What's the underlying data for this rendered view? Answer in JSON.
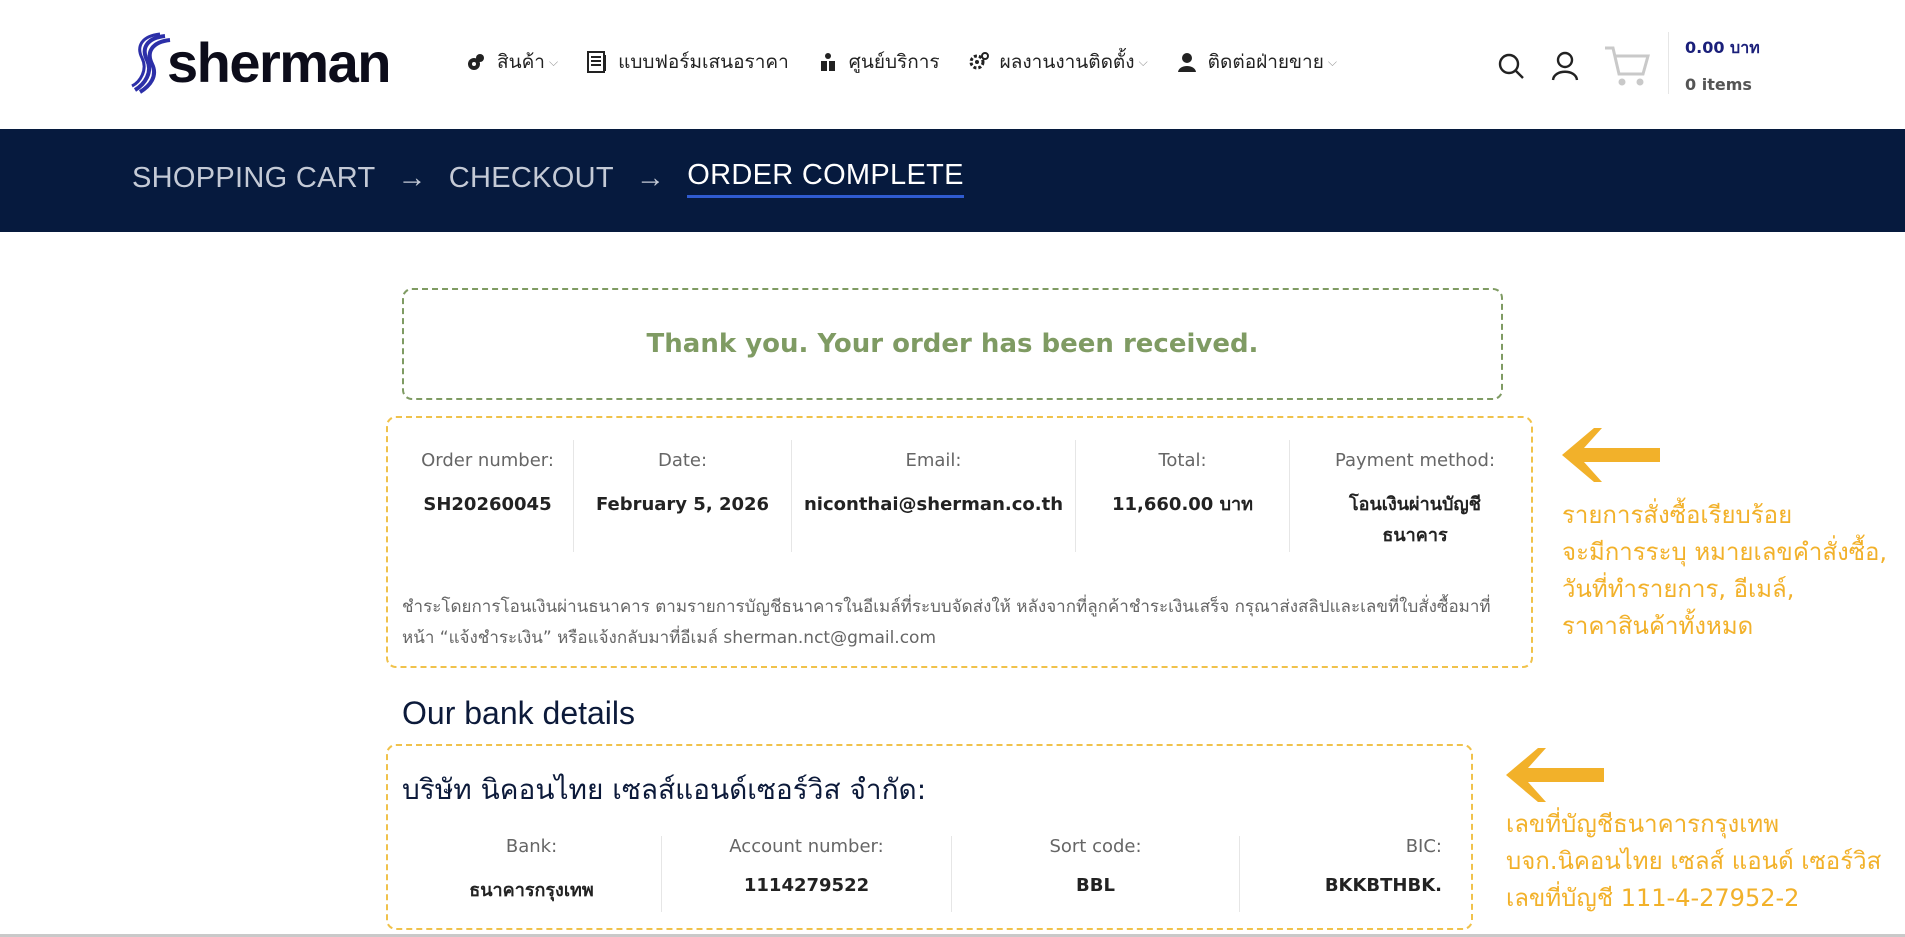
{
  "brand": {
    "name": "sherman"
  },
  "nav": {
    "items": [
      {
        "label": "สินค้า",
        "icon": "tools-icon",
        "has_dropdown": true
      },
      {
        "label": "แบบฟอร์มเสนอราคา",
        "icon": "form-icon",
        "has_dropdown": false
      },
      {
        "label": "ศูนย์บริการ",
        "icon": "service-center-icon",
        "has_dropdown": false
      },
      {
        "label": "ผลงานงานติดตั้ง",
        "icon": "gear-icon",
        "has_dropdown": true
      },
      {
        "label": "ติดต่อฝ่ายขาย",
        "icon": "user-icon",
        "has_dropdown": true
      }
    ]
  },
  "cart": {
    "total": "0.00 บาท",
    "items": "0 items"
  },
  "steps": {
    "cart": "SHOPPING CART",
    "checkout": "CHECKOUT",
    "complete": "ORDER COMPLETE",
    "arrow": "→"
  },
  "notice": {
    "text": "Thank you. Your order has been received."
  },
  "order": {
    "number_label": "Order number:",
    "number": "SH20260045",
    "date_label": "Date:",
    "date": "February 5, 2026",
    "email_label": "Email:",
    "email": "niconthai@sherman.co.th",
    "total_label": "Total:",
    "total": "11,660.00 บาท",
    "payment_label": "Payment method:",
    "payment": "โอนเงินผ่านบัญชีธนาคาร",
    "note": "ชำระโดยการโอนเงินผ่านธนาคาร ตามรายการบัญชีธนาคารในอีเมล์ที่ระบบจัดส่งให้ หลังจากที่ลูกค้าชำระเงินเสร็จ กรุณาส่งสลิปและเลขที่ใบสั่งซื้อมาที่หน้า “แจ้งชำระเงิน” หรือแจ้งกลับมาที่อีเมล์ sherman.nct@gmail.com"
  },
  "bank": {
    "title": "Our bank details",
    "company": "บริษัท นิคอนไทย เซลส์แอนด์เซอร์วิส จำกัด:",
    "bank_label": "Bank:",
    "bank": "ธนาคารกรุงเทพ",
    "account_label": "Account number:",
    "account": "1114279522",
    "sort_label": "Sort code:",
    "sort": "BBL",
    "bic_label": "BIC:",
    "bic": "BKKBTHBK."
  },
  "annotations": {
    "order_note": [
      "รายการสั่งซื้อเรียบร้อย",
      "จะมีการระบุ หมายเลขคำสั่งซื้อ,",
      "วันที่ทำรายการ, อีเมล์,",
      "ราคาสินค้าทั้งหมด"
    ],
    "bank_note": [
      "เลขที่บัญชีธนาคารกรุงเทพ",
      "บจก.นิคอนไทย เซลส์ แอนด์ เซอร์วิส",
      "เลขที่บัญชี 111-4-27952-2"
    ]
  },
  "colors": {
    "band": "#061a3e",
    "success": "#7f9b63",
    "highlight": "#f0c24b",
    "annotation": "#f2b12a",
    "accent": "#1a1f7a"
  }
}
